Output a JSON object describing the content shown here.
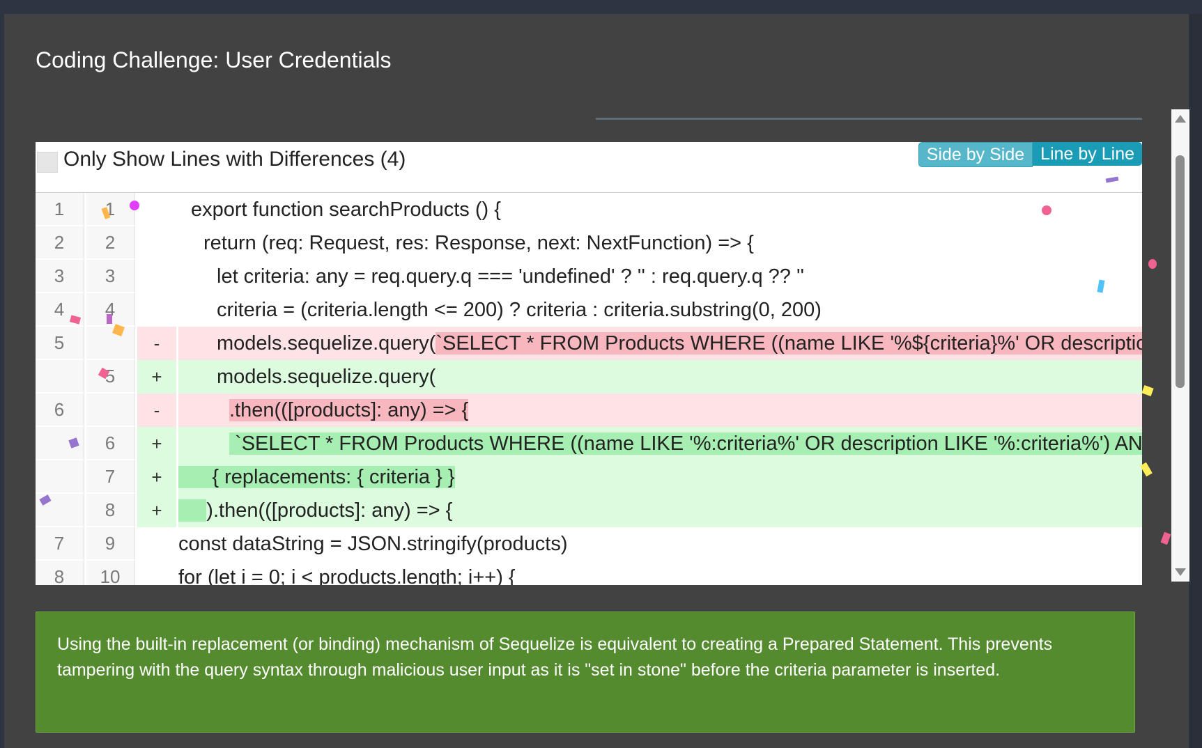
{
  "dialog": {
    "title": "Coding Challenge: User Credentials"
  },
  "diff": {
    "filter_label": "Only Show Lines with Differences (4)",
    "view_modes": {
      "side_by_side": "Side by Side",
      "line_by_line": "Line by Line"
    },
    "rows": [
      {
        "type": "ctx",
        "old": "1",
        "new": "1",
        "op": "",
        "indent": 1,
        "code": "export function searchProducts () {"
      },
      {
        "type": "ctx",
        "old": "2",
        "new": "2",
        "op": "",
        "indent": 2,
        "code": "return (req: Request, res: Response, next: NextFunction) => {"
      },
      {
        "type": "ctx",
        "old": "3",
        "new": "3",
        "op": "",
        "indent": 3,
        "code": "let criteria: any = req.query.q === 'undefined' ? '' : req.query.q ?? ''"
      },
      {
        "type": "ctx",
        "old": "4",
        "new": "4",
        "op": "",
        "indent": 3,
        "code": "criteria = (criteria.length <= 200) ? criteria : criteria.substring(0, 200)"
      },
      {
        "type": "del",
        "old": "5",
        "new": "",
        "op": "-",
        "indent": 3,
        "code": "models.sequelize.query(",
        "highlight": "`SELECT * FROM Products WHERE ((name LIKE '%${criteria}%' OR description LIKE '%${criteria}%') AND deletedAt IS NULL) ORDER BY name`)"
      },
      {
        "type": "add",
        "old": "",
        "new": "5",
        "op": "+",
        "indent": 3,
        "code": "models.sequelize.query("
      },
      {
        "type": "del",
        "old": "6",
        "new": "",
        "op": "-",
        "indent": 4,
        "code": "",
        "highlight": ".then(([products]: any) => {"
      },
      {
        "type": "add",
        "old": "",
        "new": "6",
        "op": "+",
        "indent": 4,
        "code": "",
        "highlight": " `SELECT * FROM Products WHERE ((name LIKE '%:criteria%' OR description LIKE '%:criteria%') AND deletedAt IS NULL) ORDER BY name`,"
      },
      {
        "type": "add",
        "old": "",
        "new": "7",
        "op": "+",
        "indent": 0,
        "code": "",
        "highlight": "      { replacements: { criteria } }"
      },
      {
        "type": "add",
        "old": "",
        "new": "8",
        "op": "+",
        "indent": 0,
        "code": ").then(([products]: any) => {",
        "highlight": "     "
      },
      {
        "type": "ctx",
        "old": "7",
        "new": "9",
        "op": "",
        "indent": 5,
        "code": "const dataString = JSON.stringify(products)"
      },
      {
        "type": "ctx",
        "old": "8",
        "new": "10",
        "op": "",
        "indent": 5,
        "code": "for (let i = 0; i < products.length; i++) {"
      }
    ]
  },
  "explanation": "Using the built-in replacement (or binding) mechanism of Sequelize is equivalent to creating a Prepared Statement. This prevents tampering with the query syntax through malicious user input as it is \"set in stone\" before the criteria parameter is inserted.",
  "colors": {
    "dialog_bg": "#424242",
    "deleted_line": "#fde3e6",
    "added_line": "#dcfbdf",
    "explanation_bg": "#548b2f",
    "toggle_active": "#1a9cb6"
  }
}
